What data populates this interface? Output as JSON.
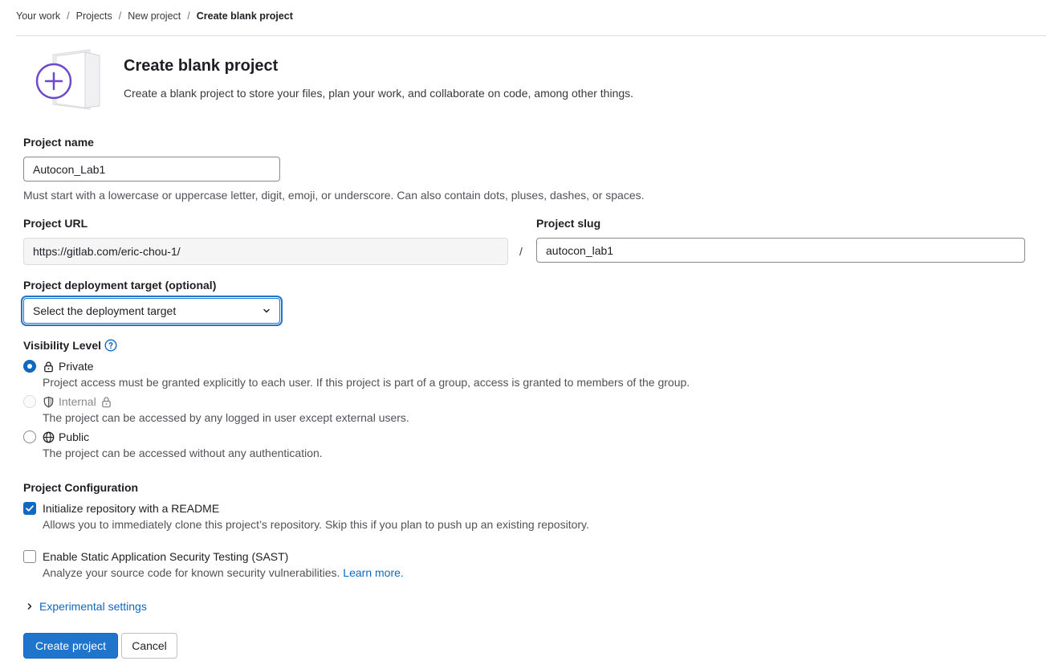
{
  "breadcrumb": {
    "items": [
      "Your work",
      "Projects",
      "New project"
    ],
    "current": "Create blank project",
    "separator": "/"
  },
  "header": {
    "title": "Create blank project",
    "subtitle": "Create a blank project to store your files, plan your work, and collaborate on code, among other things."
  },
  "project_name": {
    "label": "Project name",
    "value": "Autocon_Lab1",
    "help": "Must start with a lowercase or uppercase letter, digit, emoji, or underscore. Can also contain dots, pluses, dashes, or spaces."
  },
  "project_url": {
    "label": "Project URL",
    "value": "https://gitlab.com/eric-chou-1/",
    "separator": "/"
  },
  "project_slug": {
    "label": "Project slug",
    "value": "autocon_lab1"
  },
  "deployment": {
    "label": "Project deployment target (optional)",
    "selected": "Select the deployment target"
  },
  "visibility": {
    "label": "Visibility Level",
    "options": [
      {
        "label": "Private",
        "icon": "lock-icon",
        "checked": true,
        "disabled": false,
        "description": "Project access must be granted explicitly to each user. If this project is part of a group, access is granted to members of the group."
      },
      {
        "label": "Internal",
        "icon": "shield-icon",
        "checked": false,
        "disabled": true,
        "description": "The project can be accessed by any logged in user except external users."
      },
      {
        "label": "Public",
        "icon": "globe-icon",
        "checked": false,
        "disabled": false,
        "description": "The project can be accessed without any authentication."
      }
    ]
  },
  "configuration": {
    "label": "Project Configuration",
    "readme": {
      "label": "Initialize repository with a README",
      "checked": true,
      "description": "Allows you to immediately clone this project’s repository. Skip this if you plan to push up an existing repository."
    },
    "sast": {
      "label": "Enable Static Application Security Testing (SAST)",
      "checked": false,
      "description": "Analyze your source code for known security vulnerabilities.",
      "link": "Learn more."
    }
  },
  "experimental": {
    "label": "Experimental settings"
  },
  "actions": {
    "create": "Create project",
    "cancel": "Cancel"
  },
  "colors": {
    "accent": "#1f75cb",
    "link": "#1068bf",
    "illustration": "#6e49cb"
  }
}
